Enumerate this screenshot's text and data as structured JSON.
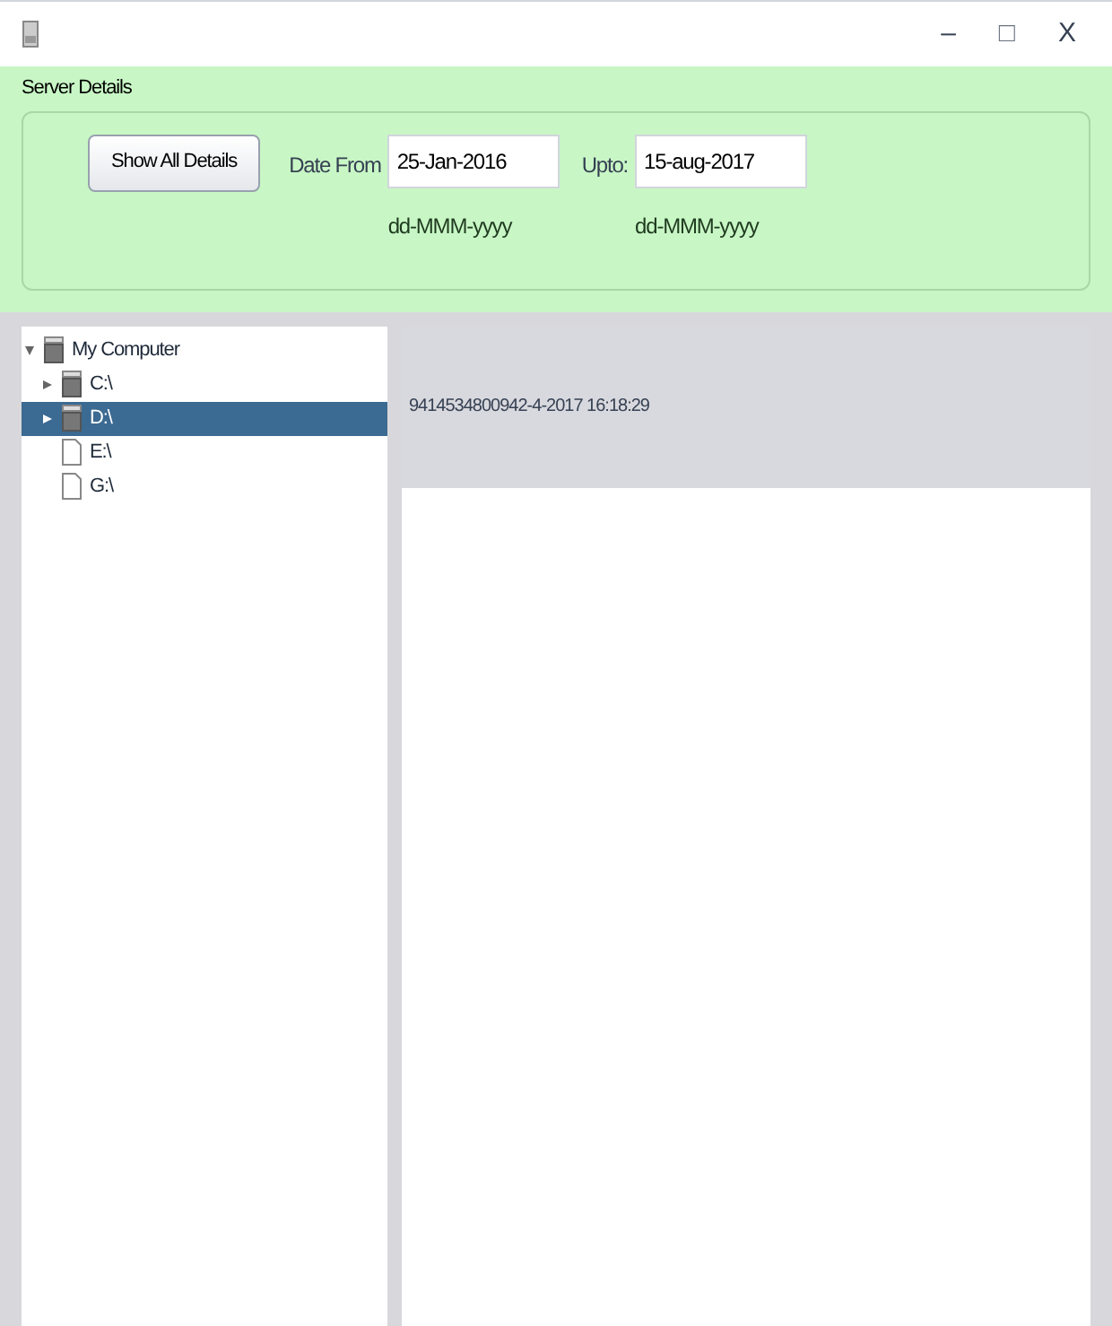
{
  "window": {
    "controls": [
      "–",
      "□",
      "X"
    ]
  },
  "panel": {
    "title": "Server Details",
    "button": "Show All Details",
    "fields": [
      {
        "label": "Date From",
        "value": "25-Jan-2016",
        "hint": "dd-MMM-yyyy"
      },
      {
        "label": "Upto:",
        "value": "15-aug-2017",
        "hint": "dd-MMM-yyyy"
      }
    ]
  },
  "tree": {
    "label": "My Computer",
    "expanded": true,
    "selected": false,
    "kind": "drive",
    "children": [
      {
        "label": "C:\\",
        "kind": "drive",
        "expanded": false,
        "selected": false
      },
      {
        "label": "D:\\",
        "kind": "drive",
        "expanded": false,
        "selected": true
      },
      {
        "label": "E:\\",
        "kind": "file",
        "selected": false
      },
      {
        "label": "G:\\",
        "kind": "file",
        "selected": false
      }
    ]
  },
  "details": {
    "text": "9414534800942-4-2017 16:18:29"
  }
}
